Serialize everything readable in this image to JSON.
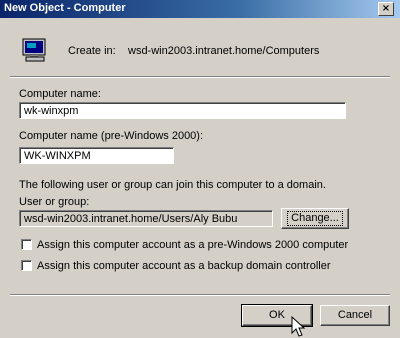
{
  "window": {
    "title": "New Object - Computer",
    "close_glyph": "×"
  },
  "header": {
    "icon": "computer-icon",
    "create_in_label": "Create in:",
    "create_in_value": "wsd-win2003.intranet.home/Computers"
  },
  "form": {
    "computer_name_label": "Computer name:",
    "computer_name_value": "wk-winxpm",
    "pre2000_label": "Computer name (pre-Windows 2000):",
    "pre2000_value": "WK-WINXPM",
    "join_text": "The following user or group can join this computer to a domain.",
    "user_group_label": "User or group:",
    "user_group_value": "wsd-win2003.intranet.home/Users/Aly Bubu",
    "change_button": "Change...",
    "checkbox1_label": "Assign this computer account as a pre-Windows 2000 computer",
    "checkbox1_checked": false,
    "checkbox2_label": "Assign this computer account as a backup domain controller",
    "checkbox2_checked": false
  },
  "footer": {
    "ok_button": "OK",
    "cancel_button": "Cancel"
  },
  "colors": {
    "titlebar_start": "#0a246a",
    "titlebar_end": "#a6caf0",
    "face": "#d4d0c8"
  }
}
